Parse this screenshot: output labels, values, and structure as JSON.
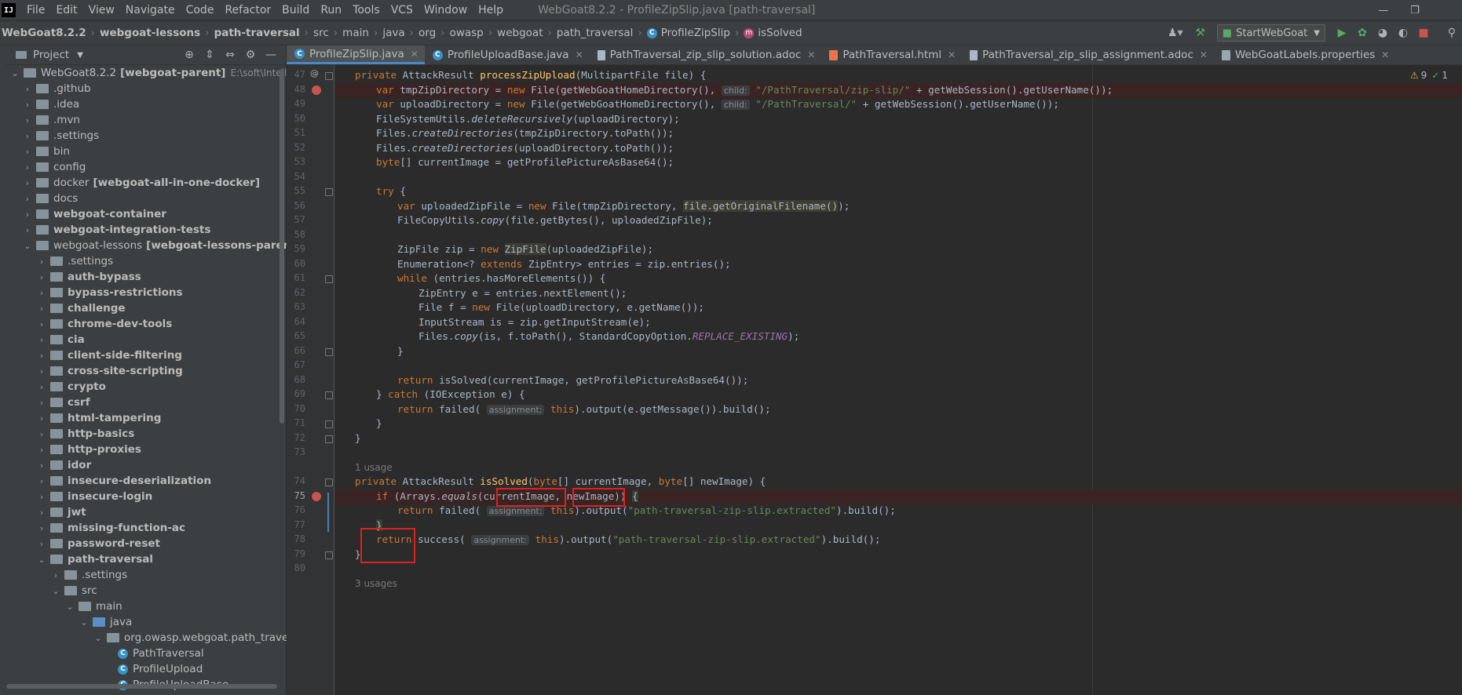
{
  "menubar": {
    "logo": "IJ",
    "items": [
      "File",
      "Edit",
      "View",
      "Navigate",
      "Code",
      "Refactor",
      "Build",
      "Run",
      "Tools",
      "VCS",
      "Window",
      "Help"
    ],
    "window_title": "WebGoat8.2.2 - ProfileZipSlip.java [path-traversal]"
  },
  "breadcrumb": [
    "WebGoat8.2.2",
    "webgoat-lessons",
    "path-traversal",
    "src",
    "main",
    "java",
    "org",
    "owasp",
    "webgoat",
    "path_traversal",
    "ProfileZipSlip",
    "isSolved"
  ],
  "toolbar": {
    "run_config": "StartWebGoat"
  },
  "project": {
    "title": "Project",
    "root_name": "WebGoat8.2.2",
    "root_module": "[webgoat-parent]",
    "root_path": "E:\\soft\\Intellij-IDEA",
    "items": [
      {
        "label": ".github",
        "bold": false
      },
      {
        "label": ".idea",
        "bold": false
      },
      {
        "label": ".mvn",
        "bold": false
      },
      {
        "label": ".settings",
        "bold": false
      },
      {
        "label": "bin",
        "bold": false
      },
      {
        "label": "config",
        "bold": false
      },
      {
        "label": "docker",
        "module": "[webgoat-all-in-one-docker]",
        "bold": false
      },
      {
        "label": "docs",
        "bold": false
      },
      {
        "label": "webgoat-container",
        "bold": true
      },
      {
        "label": "webgoat-integration-tests",
        "bold": true
      },
      {
        "label": "webgoat-lessons",
        "module": "[webgoat-lessons-parent]",
        "bold": false
      }
    ],
    "lessons": [
      ".settings",
      "auth-bypass",
      "bypass-restrictions",
      "challenge",
      "chrome-dev-tools",
      "cia",
      "client-side-filtering",
      "cross-site-scripting",
      "crypto",
      "csrf",
      "html-tampering",
      "http-basics",
      "http-proxies",
      "idor",
      "insecure-deserialization",
      "insecure-login",
      "jwt",
      "missing-function-ac",
      "password-reset",
      "path-traversal"
    ],
    "path_traversal_children": [
      ".settings",
      "src"
    ],
    "src_children": [
      "main"
    ],
    "main_children": [
      "java"
    ],
    "package": "org.owasp.webgoat.path_traversal",
    "classes": [
      "PathTraversal",
      "ProfileUpload",
      "ProfileUploadBase"
    ]
  },
  "tabs": [
    {
      "label": "ProfileZipSlip.java",
      "type": "java",
      "active": true
    },
    {
      "label": "ProfileUploadBase.java",
      "type": "java",
      "active": false
    },
    {
      "label": "PathTraversal_zip_slip_solution.adoc",
      "type": "doc",
      "active": false
    },
    {
      "label": "PathTraversal.html",
      "type": "html",
      "active": false
    },
    {
      "label": "PathTraversal_zip_slip_assignment.adoc",
      "type": "doc",
      "active": false
    },
    {
      "label": "WebGoatLabels.properties",
      "type": "props",
      "active": false
    }
  ],
  "inspections": {
    "warnings": "9",
    "ok": "1"
  },
  "editor": {
    "line_numbers": [
      "47",
      "48",
      "49",
      "50",
      "51",
      "52",
      "53",
      "54",
      "55",
      "56",
      "57",
      "58",
      "59",
      "60",
      "61",
      "62",
      "63",
      "64",
      "65",
      "66",
      "67",
      "68",
      "69",
      "70",
      "71",
      "72",
      "73",
      "",
      "74",
      "75",
      "76",
      "77",
      "78",
      "79",
      "80"
    ],
    "usage_1": "1 usage",
    "usage_2": "3 usages",
    "hint_child": "child:",
    "hint_assignment": "assignment:",
    "s_zip_slip": "\"/PathTraversal/zip-slip/\"",
    "s_path": "\"/PathTraversal/\"",
    "s_extracted": "\"path-traversal-zip-slip.extracted\""
  }
}
